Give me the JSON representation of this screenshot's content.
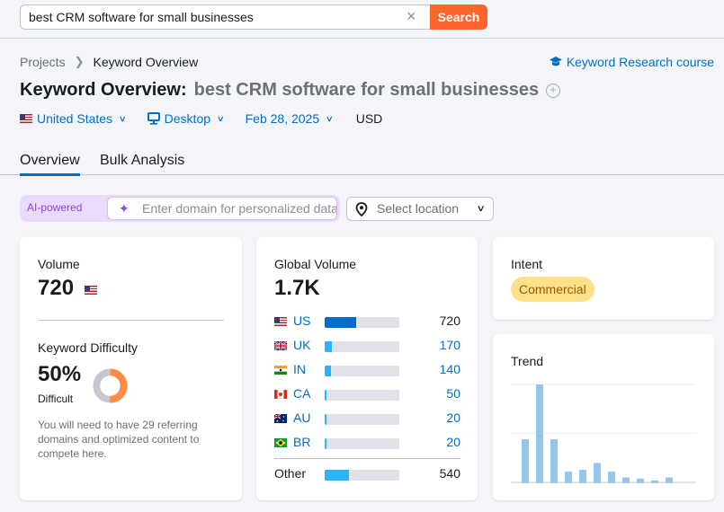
{
  "search": {
    "query": "best CRM software for small businesses",
    "clear_icon": "close-icon",
    "button_label": "Search"
  },
  "breadcrumb": {
    "items": [
      "Projects",
      "Keyword Overview"
    ]
  },
  "course_link": {
    "icon": "graduation-cap-icon",
    "label": "Keyword Research course"
  },
  "title": {
    "prefix": "Keyword Overview:",
    "keyword": "best CRM software for small businesses",
    "add_icon": "plus-circle-icon"
  },
  "filters": {
    "country": "United States",
    "device": "Desktop",
    "date": "Feb 28, 2025",
    "currency": "USD"
  },
  "tabs": [
    {
      "label": "Overview",
      "active": true
    },
    {
      "label": "Bulk Analysis",
      "active": false
    }
  ],
  "ai_bar": {
    "badge": "AI-powered",
    "placeholder": "Enter domain for personalized data",
    "location_placeholder": "Select location"
  },
  "volume_card": {
    "label": "Volume",
    "value": "720",
    "country_flag": "US",
    "kd_label": "Keyword Difficulty",
    "kd_value": "50%",
    "kd_percent": 50,
    "kd_level": "Difficult",
    "kd_description": "You will need to have 29 referring domains and optimized content to compete here.",
    "colors": {
      "kd_fill": "#ff8c43",
      "kd_track": "#c5c7cf"
    }
  },
  "global_volume_card": {
    "label": "Global Volume",
    "value": "1.7K",
    "countries": [
      {
        "code": "US",
        "value": "720",
        "share": 0.42
      },
      {
        "code": "UK",
        "value": "170",
        "share": 0.1
      },
      {
        "code": "IN",
        "value": "140",
        "share": 0.08
      },
      {
        "code": "CA",
        "value": "50",
        "share": 0.03
      },
      {
        "code": "AU",
        "value": "20",
        "share": 0.03
      },
      {
        "code": "BR",
        "value": "20",
        "share": 0.03
      }
    ],
    "other": {
      "label": "Other",
      "value": "540",
      "share": 0.32
    },
    "colors": {
      "primary_bar": "#006dca",
      "secondary_bar": "#2bb3ff",
      "track": "#e0e1e9"
    }
  },
  "intent_card": {
    "label": "Intent",
    "badge": "Commercial"
  },
  "trend_card": {
    "label": "Trend"
  },
  "chart_data": {
    "type": "bar",
    "title": "Trend",
    "values": [
      0.44,
      1.0,
      0.44,
      0.11,
      0.13,
      0.2,
      0.11,
      0.05,
      0.04,
      0.02,
      0.05,
      0
    ],
    "ylim": [
      0,
      1
    ],
    "grid": true,
    "color": "#92c6ef"
  }
}
